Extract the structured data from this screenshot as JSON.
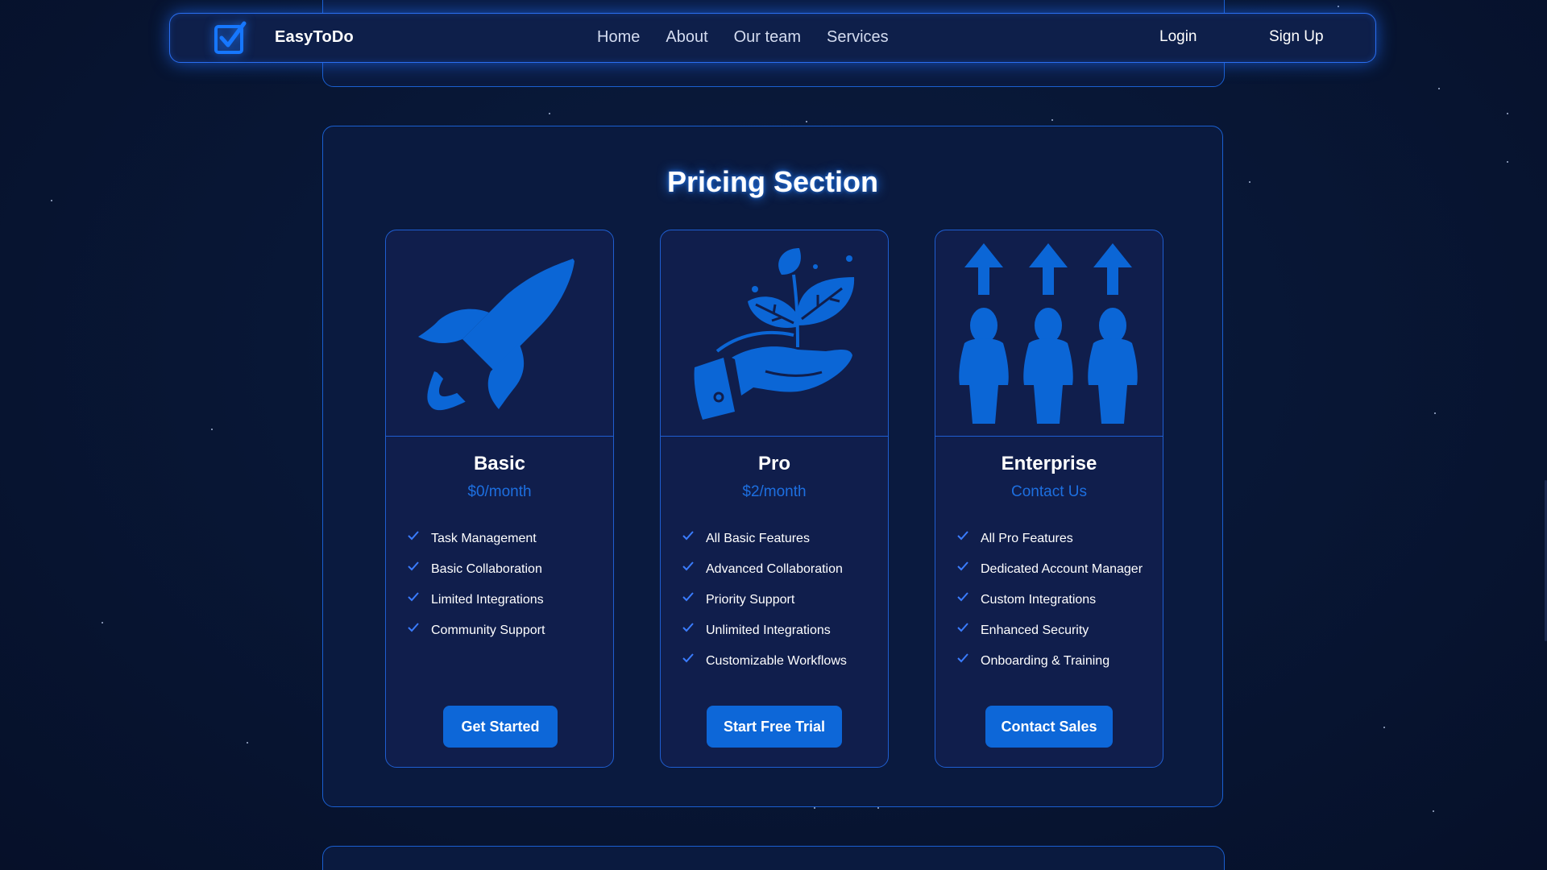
{
  "navbar": {
    "brand": "EasyToDo",
    "logo_icon": "checkbox-icon",
    "links": [
      "Home",
      "About",
      "Our team",
      "Services"
    ],
    "login": "Login",
    "signup": "Sign Up"
  },
  "pricing": {
    "title": "Pricing Section",
    "plans": [
      {
        "name": "Basic",
        "price": "$0/month",
        "illustration": "rocket-icon",
        "features": [
          "Task Management",
          "Basic Collaboration",
          "Limited Integrations",
          "Community Support"
        ],
        "cta": "Get Started"
      },
      {
        "name": "Pro",
        "price": "$2/month",
        "illustration": "plant-in-hand-icon",
        "features": [
          "All Basic Features",
          "Advanced Collaboration",
          "Priority Support",
          "Unlimited Integrations",
          "Customizable Workflows"
        ],
        "cta": "Start Free Trial"
      },
      {
        "name": "Enterprise",
        "price": "Contact Us",
        "illustration": "people-growth-icon",
        "features": [
          "All Pro Features",
          "Dedicated Account Manager",
          "Custom Integrations",
          "Enhanced Security",
          "Onboarding & Training"
        ],
        "cta": "Contact Sales"
      }
    ]
  },
  "colors": {
    "background": "#071330",
    "card": "#101e4c",
    "accent": "#0d67d8",
    "price": "#1d6fe0",
    "border": "#1f5ed0"
  }
}
